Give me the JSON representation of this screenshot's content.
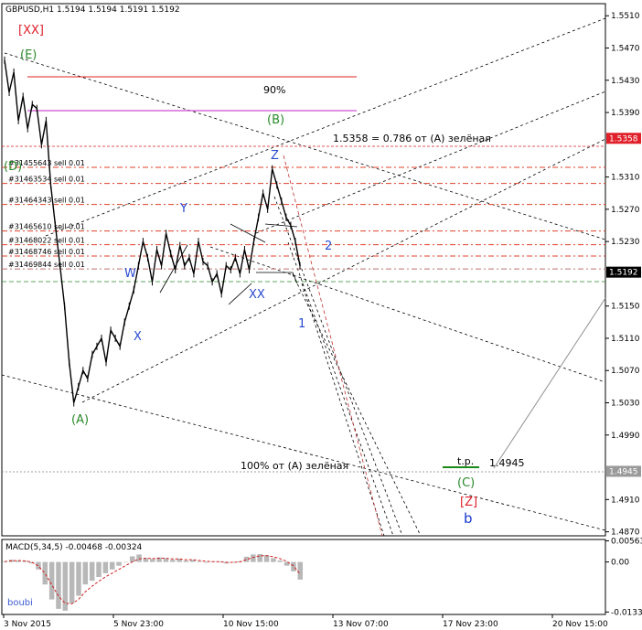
{
  "header": {
    "symbol_line": "GBPUSD,H1  1.5194 1.5194 1.5191 1.5192"
  },
  "chart_data": [
    {
      "type": "line",
      "title": "GBPUSD,H1  1.5194 1.5194 1.5191 1.5192",
      "x_tick_labels": [
        "3 Nov 2015",
        "5 Nov 23:00",
        "10 Nov 15:00",
        "13 Nov 07:00",
        "17 Nov 23:00",
        "20 Nov 15:00"
      ],
      "y_tick_labels": [
        "1.5510",
        "1.5470",
        "1.5430",
        "1.5390",
        "1.5310",
        "1.5270",
        "1.5230",
        "1.5150",
        "1.5110",
        "1.5070",
        "1.5030",
        "1.4990",
        "1.4910",
        "1.4870"
      ],
      "ylim": [
        1.4865,
        1.5525
      ],
      "price_tags": [
        {
          "value": 1.5358,
          "label": "1.5358",
          "color": "#e0202a"
        },
        {
          "value": 1.5192,
          "label": "1.5192",
          "color": "#000000"
        },
        {
          "value": 1.4945,
          "label": "1.4945",
          "color": "#9a9a9a"
        }
      ],
      "series": [
        {
          "values": [
            1.5455,
            1.5415,
            1.544,
            1.538,
            1.541,
            1.537,
            1.54,
            1.5395,
            1.535,
            1.538,
            1.53,
            1.525,
            1.52,
            1.515,
            1.508,
            1.503,
            1.505,
            1.507,
            1.506,
            1.509,
            1.51,
            1.511,
            1.508,
            1.512,
            1.511,
            1.51,
            1.513,
            1.515,
            1.517,
            1.52,
            1.523,
            1.521,
            1.518,
            1.522,
            1.52,
            1.524,
            1.5215,
            1.5195,
            1.5225,
            1.52,
            1.521,
            1.519,
            1.523,
            1.5205,
            1.52,
            1.518,
            1.519,
            1.5165,
            1.52,
            1.5195,
            1.521,
            1.519,
            1.522,
            1.5195,
            1.523,
            1.526,
            1.529,
            1.527,
            1.532,
            1.53,
            1.528,
            1.526,
            1.525,
            1.523,
            1.52
          ]
        }
      ],
      "horizontal_levels": [
        {
          "label": "#31455643 sell 0.01",
          "value": 1.5322,
          "color": "#e0402a"
        },
        {
          "label": "#31463534 sell 0.01",
          "value": 1.5302,
          "color": "#e0402a"
        },
        {
          "label": "#31464343 sell 0.01",
          "value": 1.5276,
          "color": "#e0402a"
        },
        {
          "label": "#31465610 sell 0.01",
          "value": 1.5243,
          "color": "#e0402a"
        },
        {
          "label": "#31468022 sell 0.01",
          "value": 1.5226,
          "color": "#e0402a"
        },
        {
          "label": "#31468746 sell 0.01",
          "value": 1.5212,
          "color": "#e0402a"
        },
        {
          "label": "#31469844 sell 0.01",
          "value": 1.5196,
          "color": "#c07070"
        }
      ],
      "annotations": [
        {
          "text": "[XX]",
          "color": "#e0202a"
        },
        {
          "text": "(E)",
          "color": "#2a8a2a"
        },
        {
          "text": "(D)",
          "color": "#2a8a2a"
        },
        {
          "text": "(B)",
          "color": "#2a8a2a"
        },
        {
          "text": "(A)",
          "color": "#2a8a2a"
        },
        {
          "text": "(C)",
          "color": "#2a8a2a"
        },
        {
          "text": "90%",
          "color": "#000000"
        },
        {
          "text": "1.5358 = 0.786  от (A) зелёная",
          "color": "#000000"
        },
        {
          "text": "100% от (A) зелёная",
          "color": "#000000"
        },
        {
          "text": "t.p.",
          "color": "#000000"
        },
        {
          "text": "1.4945",
          "color": "#000000"
        },
        {
          "text": "Z",
          "color": "#2a4ad0"
        },
        {
          "text": "Y",
          "color": "#2a4ad0"
        },
        {
          "text": "W",
          "color": "#2a4ad0"
        },
        {
          "text": "X",
          "color": "#2a4ad0"
        },
        {
          "text": "XX",
          "color": "#2a4ad0"
        },
        {
          "text": "1",
          "color": "#2a4ad0"
        },
        {
          "text": "2",
          "color": "#2a4ad0"
        },
        {
          "text": "[Z]",
          "color": "#e0202a"
        },
        {
          "text": "b",
          "color": "#1a3ad0"
        }
      ]
    },
    {
      "type": "bar",
      "title": "MACD(5,34,5) -0.00468 -0.00324",
      "y_tick_labels": [
        "0.00563",
        "0.00",
        "-0.01335"
      ],
      "ylim": [
        -0.014,
        0.006
      ],
      "series": [
        {
          "values": [
            0.0002,
            0.0006,
            0.0004,
            0.0003,
            -0.0004,
            -0.002,
            -0.006,
            -0.01,
            -0.0125,
            -0.013,
            -0.011,
            -0.009,
            -0.006,
            -0.005,
            -0.004,
            -0.003,
            -0.002,
            -0.001,
            0.0,
            0.0015,
            0.002,
            0.001,
            0.0008,
            0.0012,
            0.001,
            0.0006,
            0.0009,
            0.0004,
            0.0006,
            0.0002,
            -0.0002,
            0.0001,
            0.0,
            -0.0004,
            -0.0002,
            0.0002,
            0.0014,
            0.002,
            0.0021,
            0.0018,
            0.001,
            0.0004,
            -0.001,
            -0.0025,
            -0.0047
          ]
        },
        {
          "values": [
            0.0001,
            0.0003,
            0.0004,
            0.0003,
            0.0,
            -0.001,
            -0.003,
            -0.006,
            -0.009,
            -0.011,
            -0.0112,
            -0.01,
            -0.008,
            -0.0065,
            -0.0052,
            -0.004,
            -0.003,
            -0.002,
            -0.001,
            0.0,
            0.0008,
            0.001,
            0.0009,
            0.001,
            0.001,
            0.0008,
            0.0008,
            0.0006,
            0.0006,
            0.0004,
            0.0002,
            0.0001,
            0.0001,
            -0.0001,
            -0.0001,
            0.0,
            0.0006,
            0.0012,
            0.0016,
            0.0017,
            0.0014,
            0.0009,
            0.0002,
            -0.001,
            -0.0032
          ]
        }
      ]
    }
  ],
  "footer": {
    "watermark": "boubi"
  }
}
